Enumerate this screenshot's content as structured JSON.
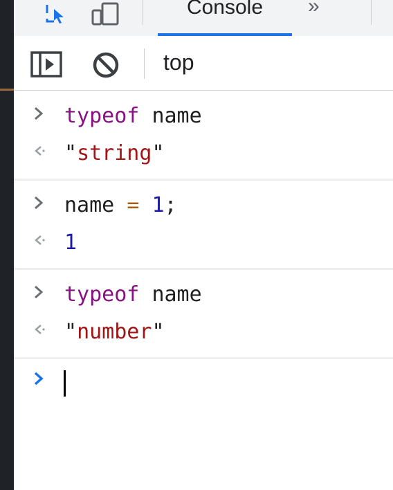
{
  "tabbar": {
    "icons": [
      "inspect-element-icon",
      "device-toolbar-icon"
    ],
    "active_tab": "Console",
    "more_tabs_label": "»"
  },
  "toolbar": {
    "icons": [
      "sidebar-toggle-icon",
      "clear-console-icon"
    ],
    "context": "top"
  },
  "console": {
    "entries": [
      {
        "input": {
          "parts": [
            [
              "typeof",
              "kw"
            ],
            [
              " ",
              "id"
            ],
            [
              "name",
              "id"
            ]
          ]
        },
        "output": {
          "value": "string",
          "type": "string"
        }
      },
      {
        "input": {
          "parts": [
            [
              "name",
              "id"
            ],
            [
              " ",
              "id"
            ],
            [
              "=",
              "op"
            ],
            [
              " ",
              "id"
            ],
            [
              "1",
              "num"
            ],
            [
              ";",
              "id"
            ]
          ]
        },
        "output": {
          "value": "1",
          "type": "number"
        }
      },
      {
        "input": {
          "parts": [
            [
              "typeof",
              "kw"
            ],
            [
              " ",
              "id"
            ],
            [
              "name",
              "id"
            ]
          ]
        },
        "output": {
          "value": "number",
          "type": "string"
        }
      }
    ]
  },
  "colors": {
    "accent": "#1a73e8",
    "keyword": "#881280",
    "string": "#a31515",
    "number": "#1a1aa6"
  }
}
